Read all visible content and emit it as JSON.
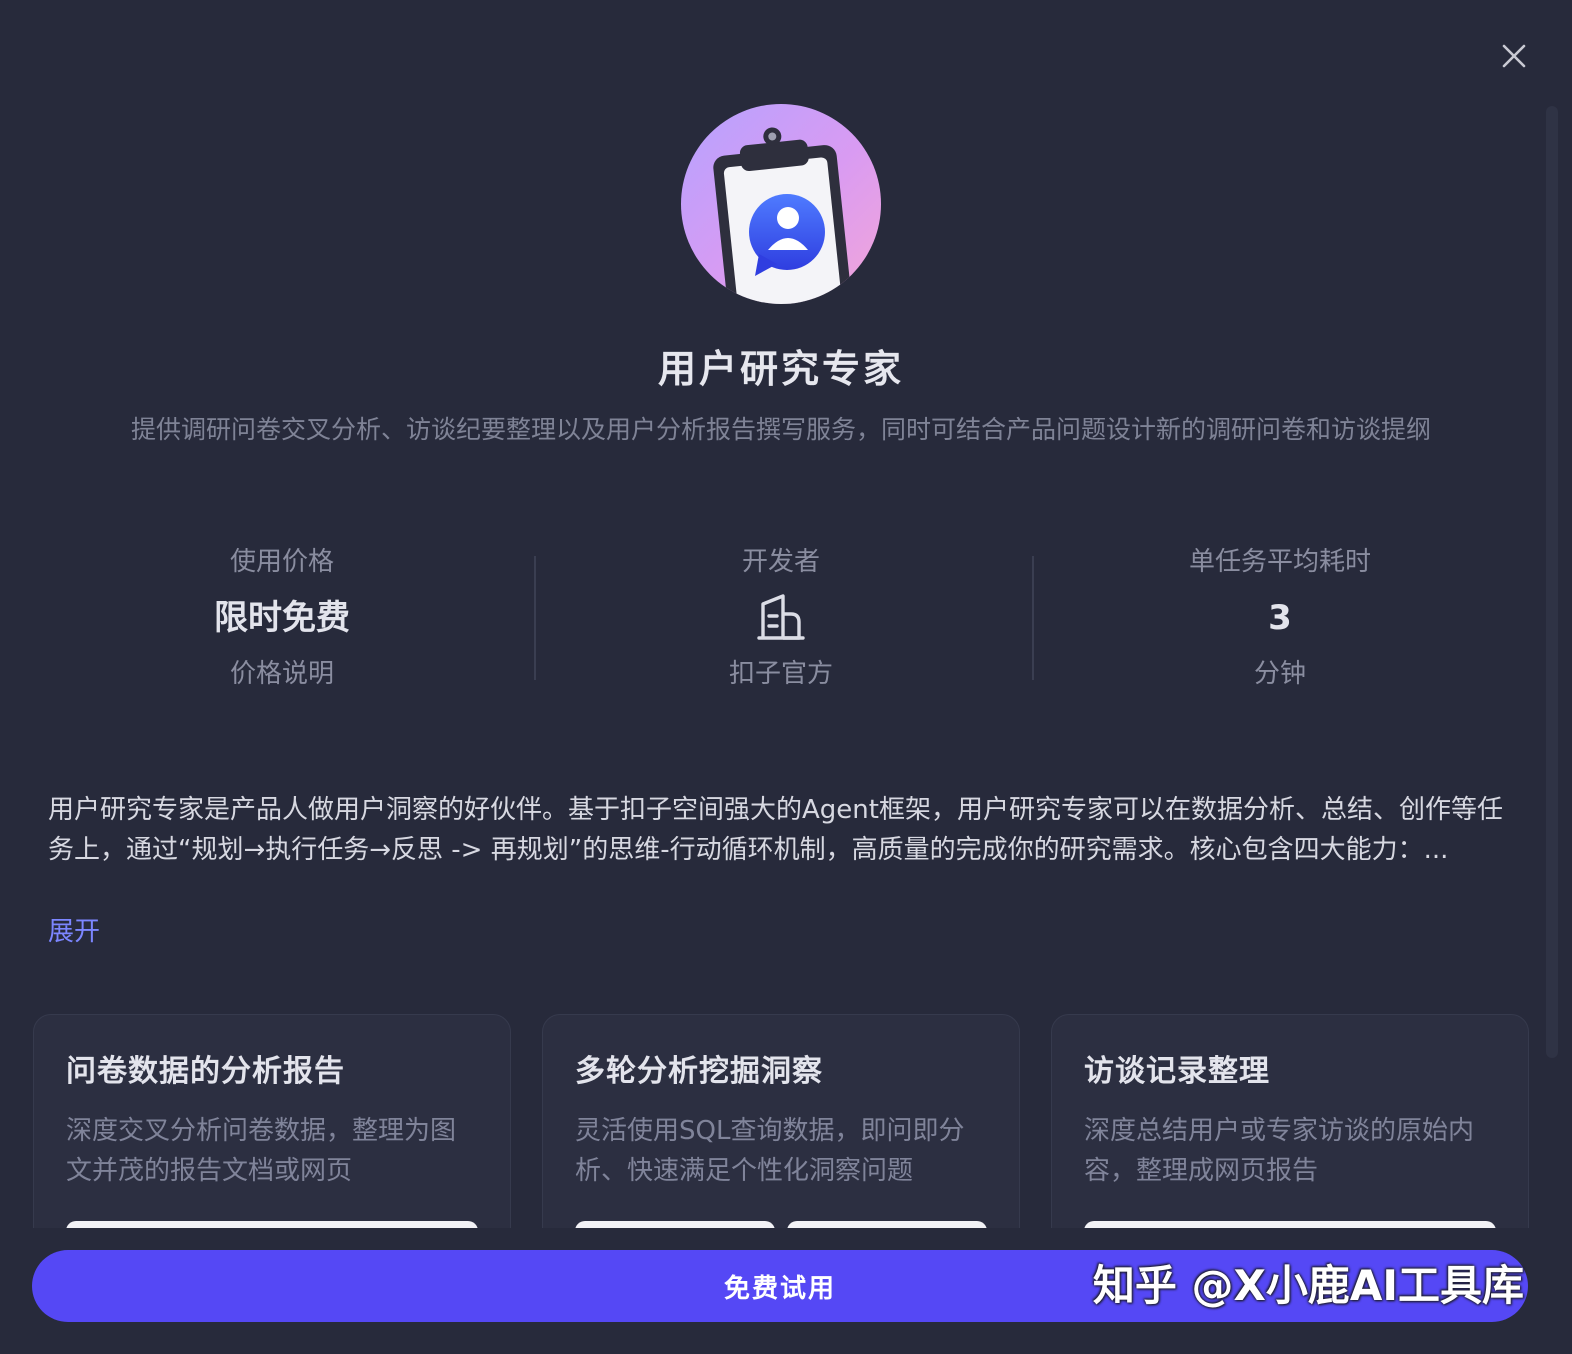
{
  "agent": {
    "title": "用户研究专家",
    "description": "提供调研问卷交叉分析、访谈纪要整理以及用户分析报告撰写服务，同时可结合产品问题设计新的调研问卷和访谈提纲"
  },
  "stats": {
    "price": {
      "label": "使用价格",
      "value": "限时免费",
      "sub": "价格说明"
    },
    "developer": {
      "label": "开发者",
      "icon": "building-icon",
      "sub": "扣子官方"
    },
    "duration": {
      "label": "单任务平均耗时",
      "value": "3",
      "sub": "分钟"
    }
  },
  "intro": {
    "text": "用户研究专家是产品人做用户洞察的好伙伴。基于扣子空间强大的Agent框架，用户研究专家可以在数据分析、总结、创作等任务上，通过“规划→执行任务→反思 -> 再规划”的思维-行动循环机制，高质量的完成你的研究需求。核心包含四大能力：...",
    "expand_label": "展开"
  },
  "capabilities": [
    {
      "title": "问卷数据的分析报告",
      "description": "深度交叉分析问卷数据，整理为图文并茂的报告文档或网页"
    },
    {
      "title": "多轮分析挖掘洞察",
      "description": "灵活使用SQL查询数据，即问即分析、快速满足个性化洞察问题"
    },
    {
      "title": "访谈记录整理",
      "description": "深度总结用户或专家访谈的原始内容，整理成网页报告"
    }
  ],
  "cta": {
    "label": "免费试用"
  },
  "watermark": {
    "text": "知乎 @X小鹿AI工具库"
  },
  "colors": {
    "background": "#272a3b",
    "accent": "#5548f5",
    "link": "#7c86ff"
  }
}
